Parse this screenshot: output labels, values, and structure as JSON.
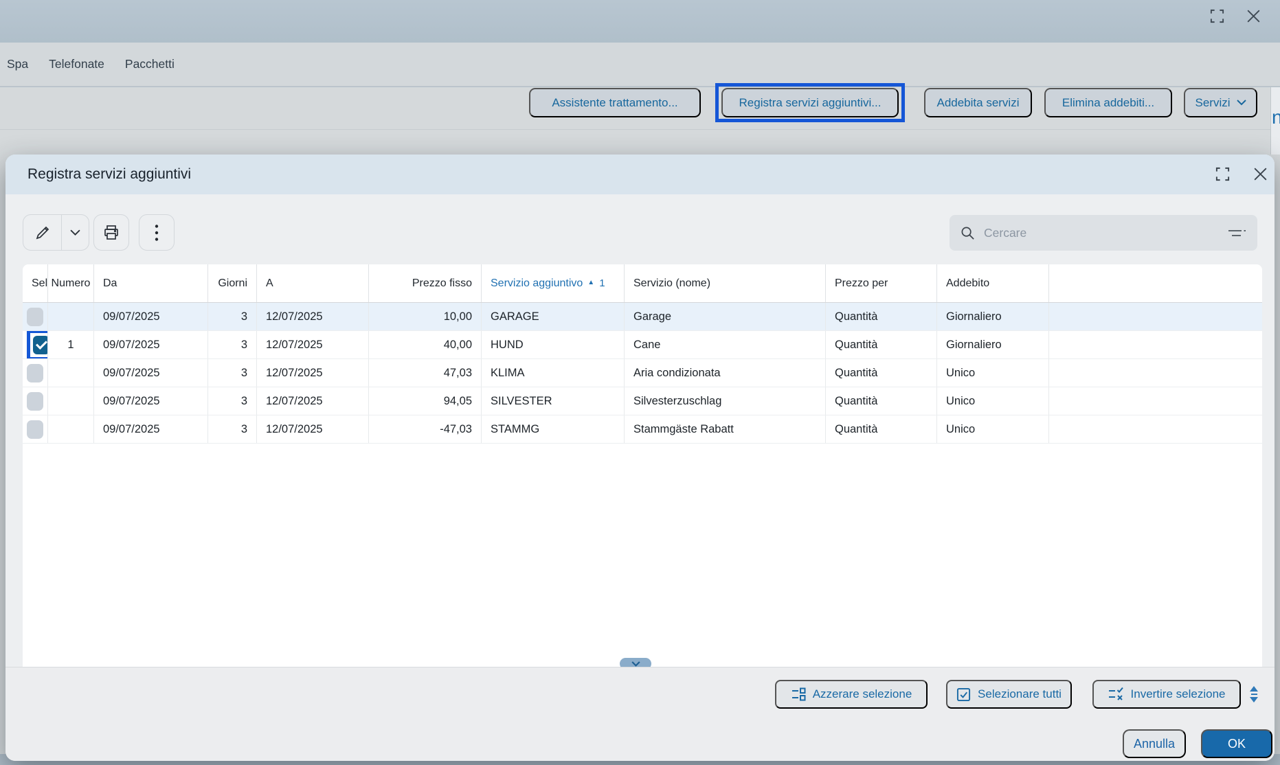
{
  "window": {
    "tabs": [
      "Spa",
      "Telefonate",
      "Pacchetti"
    ],
    "actions": {
      "assistente": "Assistente trattamento...",
      "registra": "Registra servizi aggiuntivi...",
      "addebita": "Addebita servizi",
      "elimina": "Elimina addebiti...",
      "servizi": "Servizi"
    },
    "edge_fragment": "n"
  },
  "dialog": {
    "title": "Registra servizi aggiuntivi",
    "search": {
      "placeholder": "Cercare"
    },
    "table": {
      "headers": [
        "Sel",
        "Numero",
        "Da",
        "Giorni",
        "A",
        "Prezzo fisso",
        "Servizio aggiuntivo",
        "Servizio (nome)",
        "Prezzo per",
        "Addebito",
        ""
      ],
      "sort": {
        "column": "Servizio aggiuntivo",
        "indicator": "▲",
        "order": "1"
      },
      "rows": [
        {
          "sel": false,
          "highlight": true,
          "annotated": false,
          "numero": "",
          "da": "09/07/2025",
          "giorni": "3",
          "a": "12/07/2025",
          "prezzo_fisso": "10,00",
          "servizio_aggiuntivo": "GARAGE",
          "servizio_nome": "Garage",
          "prezzo_per": "Quantità",
          "addebito": "Giornaliero"
        },
        {
          "sel": true,
          "highlight": false,
          "annotated": true,
          "numero": "1",
          "da": "09/07/2025",
          "giorni": "3",
          "a": "12/07/2025",
          "prezzo_fisso": "40,00",
          "servizio_aggiuntivo": "HUND",
          "servizio_nome": "Cane",
          "prezzo_per": "Quantità",
          "addebito": "Giornaliero"
        },
        {
          "sel": false,
          "highlight": false,
          "annotated": false,
          "numero": "",
          "da": "09/07/2025",
          "giorni": "3",
          "a": "12/07/2025",
          "prezzo_fisso": "47,03",
          "servizio_aggiuntivo": "KLIMA",
          "servizio_nome": "Aria condizionata",
          "prezzo_per": "Quantità",
          "addebito": "Unico"
        },
        {
          "sel": false,
          "highlight": false,
          "annotated": false,
          "numero": "",
          "da": "09/07/2025",
          "giorni": "3",
          "a": "12/07/2025",
          "prezzo_fisso": "94,05",
          "servizio_aggiuntivo": "SILVESTER",
          "servizio_nome": "Silvesterzuschlag",
          "prezzo_per": "Quantità",
          "addebito": "Unico"
        },
        {
          "sel": false,
          "highlight": false,
          "annotated": false,
          "numero": "",
          "da": "09/07/2025",
          "giorni": "3",
          "a": "12/07/2025",
          "prezzo_fisso": "-47,03",
          "servizio_aggiuntivo": "STAMMG",
          "servizio_nome": "Stammgäste Rabatt",
          "prezzo_per": "Quantità",
          "addebito": "Unico"
        }
      ]
    },
    "footer": {
      "clear": "Azzerare selezione",
      "select_all": "Selezionare tutti",
      "invert": "Invertire selezione"
    },
    "buttons": {
      "cancel": "Annulla",
      "ok": "OK"
    }
  },
  "colors": {
    "annotation_blue": "#1556d6",
    "accent_blue": "#17679d",
    "ok_button": "#1869aa",
    "checkbox_checked": "#11618f",
    "row_highlight": "#e8f1fa",
    "titlebar": "#d9e4ed"
  }
}
